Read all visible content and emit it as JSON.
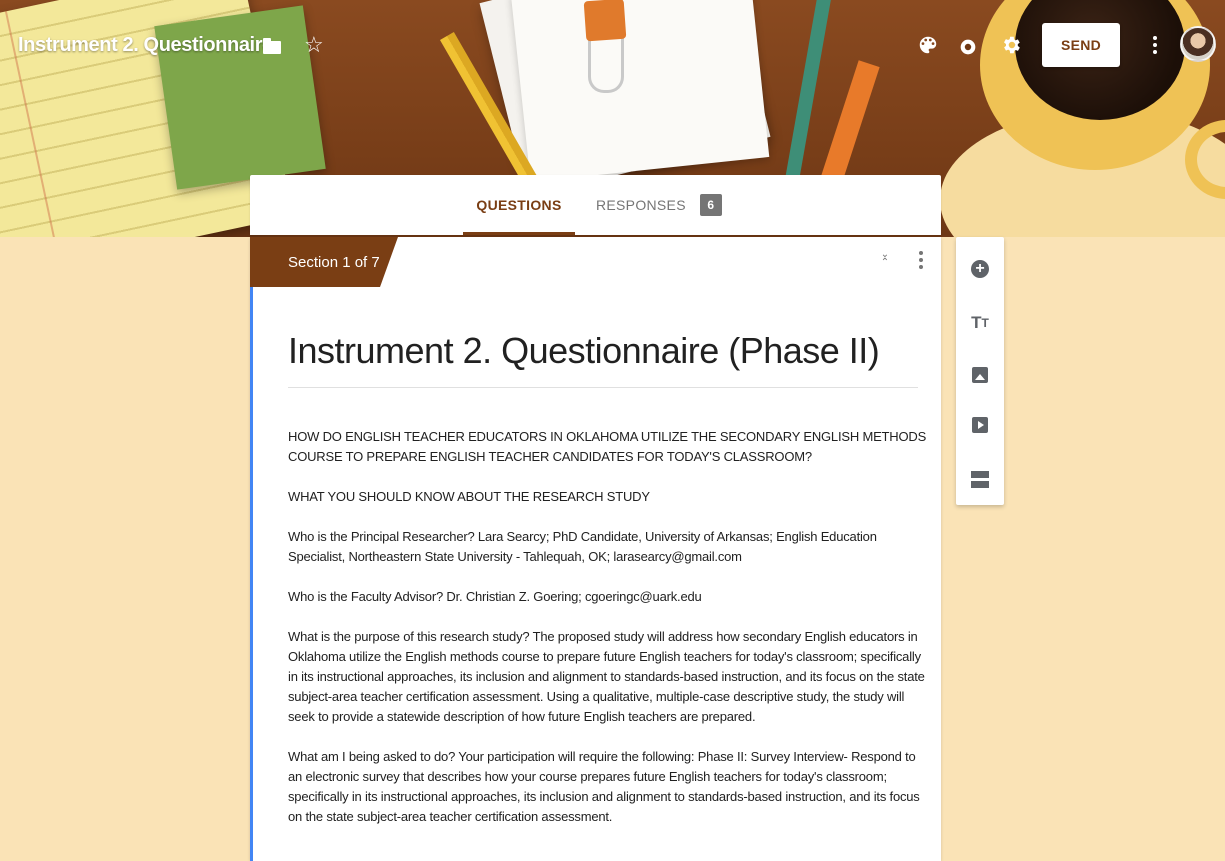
{
  "header": {
    "title": "Instrument 2. Questionnaire",
    "send_label": "SEND",
    "icons": [
      "folder-icon",
      "star-icon",
      "palette-icon",
      "eye-icon",
      "gear-icon",
      "more-vert-icon",
      "avatar"
    ]
  },
  "tabs": {
    "questions": "QUESTIONS",
    "responses": "RESPONSES",
    "responses_count": "6"
  },
  "section": {
    "label": "Section 1 of 7"
  },
  "form": {
    "title": "Instrument 2. Questionnaire (Phase II)",
    "description": [
      "HOW DO ENGLISH TEACHER EDUCATORS IN OKLAHOMA UTILIZE THE SECONDARY ENGLISH METHODS COURSE TO PREPARE ENGLISH TEACHER CANDIDATES FOR TODAY'S CLASSROOM?",
      "WHAT YOU SHOULD KNOW ABOUT THE RESEARCH STUDY",
      "Who is the Principal Researcher? Lara Searcy; PhD Candidate, University of Arkansas; English Education Specialist, Northeastern State University - Tahlequah, OK; larasearcy@gmail.com",
      "Who is the Faculty Advisor? Dr. Christian Z. Goering; cgoeringc@uark.edu",
      "What is the purpose of this research study? The proposed study will address how secondary English educators in Oklahoma utilize the English methods course to prepare future English teachers for today's classroom; specifically in its instructional approaches, its inclusion and alignment to standards-based instruction, and its focus on the state subject-area teacher certification assessment.  Using a qualitative, multiple-case descriptive study, the study will seek to provide a statewide description of how future English teachers are prepared.",
      "What am I being asked to do? Your participation will require the following: Phase II: Survey Interview- Respond to an electronic survey that describes how your course prepares future English teachers for today's classroom; specifically in its instructional approaches, its inclusion and alignment to standards-based instruction, and its focus on the state subject-area teacher certification assessment."
    ]
  },
  "toolbar": {
    "tools": [
      "add-question-icon",
      "add-title-icon",
      "add-image-icon",
      "add-video-icon",
      "add-section-icon"
    ]
  },
  "colors": {
    "theme": "#7a3e14",
    "page_background": "#fae3b6",
    "accent_bar": "#4285f4"
  }
}
